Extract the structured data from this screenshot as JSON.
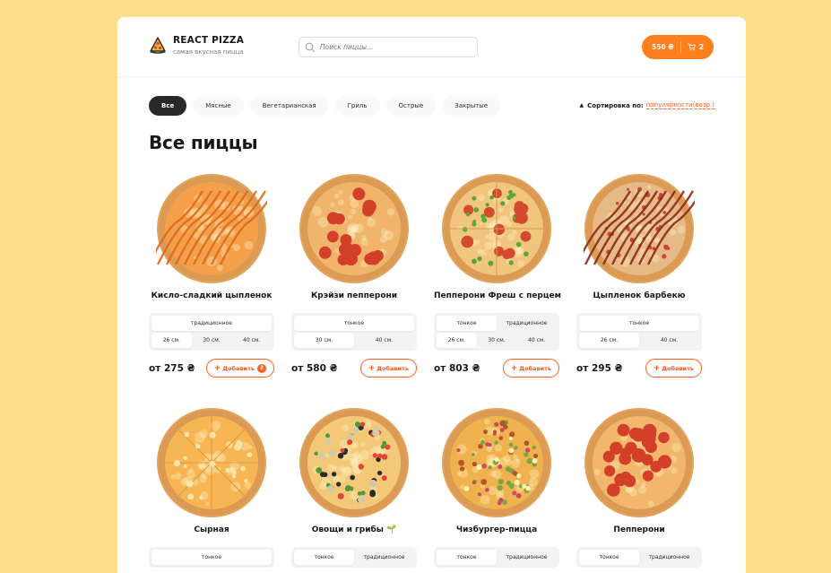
{
  "header": {
    "logo_title": "REACT PIZZA",
    "logo_subtitle": "самая вкусная пицца",
    "search_placeholder": "Поиск пиццы...",
    "cart_total": "550 ₴",
    "cart_count": "2"
  },
  "categories": [
    "Все",
    "Мясные",
    "Вегетарианская",
    "Гриль",
    "Острые",
    "Закрытые"
  ],
  "active_category": "Все",
  "sort": {
    "label": "Сортировка по:",
    "value": "популярности(возр.)"
  },
  "page_title": "Все пиццы",
  "add_label": "Добавить",
  "pizzas": [
    {
      "name": "Кисло-сладкий цыпленок",
      "types": [
        "традиционное"
      ],
      "active_type": 0,
      "sizes": [
        "26 см.",
        "30 см.",
        "40 см."
      ],
      "active_size": 0,
      "price": "от 275 ₴",
      "count": "2",
      "style": "bbq-orange"
    },
    {
      "name": "Крэйзи пепперони",
      "types": [
        "тонкое"
      ],
      "active_type": 0,
      "sizes": [
        "30 см.",
        "40 см."
      ],
      "active_size": 0,
      "price": "от 580 ₴",
      "count": "",
      "style": "pepperoni"
    },
    {
      "name": "Пепперони Фреш с перцем",
      "types": [
        "тонкое",
        "традиционное"
      ],
      "active_type": 0,
      "sizes": [
        "26 см.",
        "30 см.",
        "40 см."
      ],
      "active_size": 0,
      "price": "от 803 ₴",
      "count": "",
      "style": "pepper"
    },
    {
      "name": "Цыпленок барбекю",
      "types": [
        "тонкое"
      ],
      "active_type": 0,
      "sizes": [
        "26 см.",
        "40 см."
      ],
      "active_size": 0,
      "price": "от 295 ₴",
      "count": "",
      "style": "bbq-red"
    },
    {
      "name": "Сырная",
      "types": [
        "тонкое"
      ],
      "style": "cheese"
    },
    {
      "name": "Овощи и грибы 🌱",
      "types": [
        "тонкое",
        "традиционное"
      ],
      "style": "veggie"
    },
    {
      "name": "Чизбургер-пицца",
      "types": [
        "тонкое",
        "традиционное"
      ],
      "style": "burger"
    },
    {
      "name": "Пепперони",
      "types": [
        "тонкое",
        "традиционное"
      ],
      "style": "pepperoni2"
    }
  ],
  "colors": {
    "background": "#ffdf8c",
    "accent": "#fe5f1e",
    "cart_button": "#fe7f1e",
    "dark": "#282828"
  }
}
